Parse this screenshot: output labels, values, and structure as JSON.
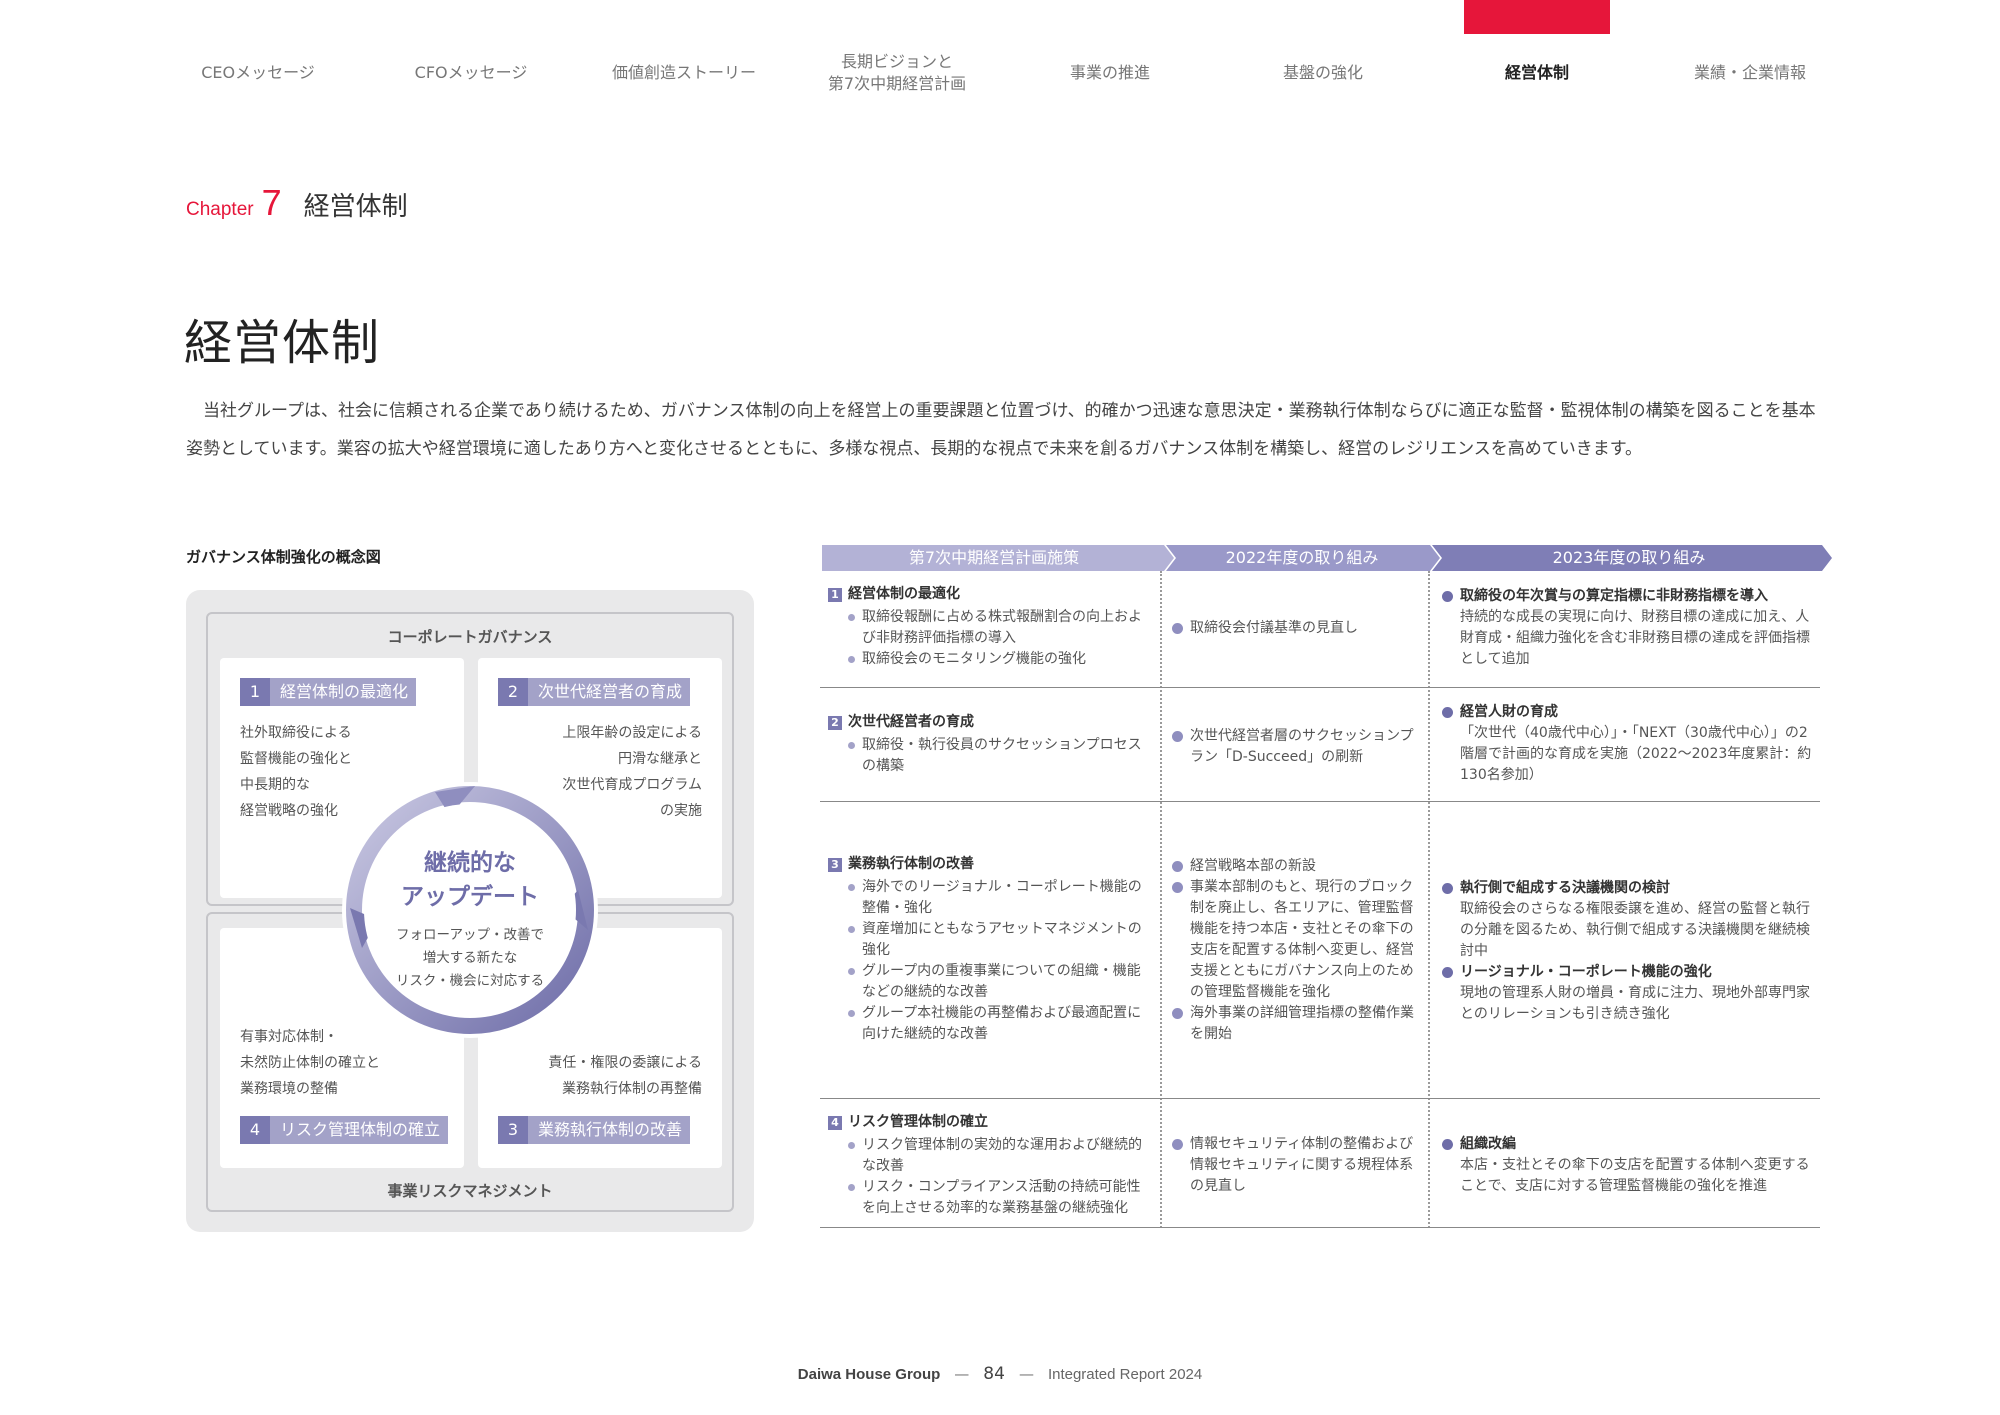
{
  "nav": {
    "items": [
      {
        "label": "CEOメッセージ",
        "label2": ""
      },
      {
        "label": "CFOメッセージ",
        "label2": ""
      },
      {
        "label": "価値創造ストーリー",
        "label2": ""
      },
      {
        "label": "長期ビジョンと",
        "label2": "第7次中期経営計画"
      },
      {
        "label": "事業の推進",
        "label2": ""
      },
      {
        "label": "基盤の強化",
        "label2": ""
      },
      {
        "label": "経営体制",
        "label2": ""
      },
      {
        "label": "業績・企業情報",
        "label2": ""
      }
    ],
    "active_index": 6,
    "marker_color": "#e6163a"
  },
  "chapter": {
    "word": "Chapter",
    "number": "7",
    "title": "経営体制"
  },
  "page_title": "経営体制",
  "intro": "当社グループは、社会に信頼される企業であり続けるため、ガバナンス体制の向上を経営上の重要課題と位置づけ、的確かつ迅速な意思決定・業務執行体制ならびに適正な監督・監視体制の構築を図ることを基本姿勢としています。業容の拡大や経営環境に適したあり方へと変化させるとともに、多様な視点、長期的な視点で未来を創るガバナンス体制を構築し、経営のレジリエンスを高めていきます。",
  "diagram": {
    "label": "ガバナンス体制強化の概念図",
    "top_title": "コーポレートガバナンス",
    "bottom_title": "事業リスクマネジメント",
    "cards": [
      {
        "num": "1",
        "title": "経営体制の最適化",
        "body": [
          "社外取締役による",
          "監督機能の強化と",
          "中長期的な",
          "経営戦略の強化"
        ]
      },
      {
        "num": "2",
        "title": "次世代経営者の育成",
        "body": [
          "上限年齢の設定による",
          "円滑な継承と",
          "次世代育成プログラム",
          "の実施"
        ]
      },
      {
        "num": "4",
        "title": "リスク管理体制の確立",
        "body": [
          "有事対応体制・",
          "未然防止体制の確立と",
          "業務環境の整備"
        ]
      },
      {
        "num": "3",
        "title": "業務執行体制の改善",
        "body": [
          "責任・権限の委譲による",
          "業務執行体制の再整備"
        ]
      }
    ],
    "center": {
      "title1": "継続的な",
      "title2": "アップデート",
      "sub": [
        "フォローアップ・改善で",
        "増大する新たな",
        "リスク・機会に対応する"
      ]
    },
    "accent": "#7a79b0"
  },
  "table": {
    "headers": [
      "第7次中期経営計画施策",
      "2022年度の取り組み",
      "2023年度の取り組み"
    ],
    "header_colors": [
      "#b3b2d6",
      "#9a99c9",
      "#7f7eb6"
    ],
    "rows": [
      {
        "num": "1",
        "title": "経営体制の最適化",
        "items": [
          "取締役報酬に占める株式報酬割合の向上および非財務評価指標の導入",
          "取締役会のモニタリング機能の強化"
        ],
        "fy2022": [
          "取締役会付議基準の見直し"
        ],
        "fy2023": [
          {
            "head": "取締役の年次賞与の算定指標に非財務指標を導入",
            "body": "持続的な成長の実現に向け、財務目標の達成に加え、人財育成・組織力強化を含む非財務目標の達成を評価指標として追加"
          }
        ]
      },
      {
        "num": "2",
        "title": "次世代経営者の育成",
        "items": [
          "取締役・執行役員のサクセッションプロセスの構築"
        ],
        "fy2022": [
          "次世代経営者層のサクセッションプラン「D-Succeed」の刷新"
        ],
        "fy2023": [
          {
            "head": "経営人財の育成",
            "body": "「次世代（40歳代中心）」・「NEXT（30歳代中心）」の2階層で計画的な育成を実施（2022～2023年度累計：約130名参加）"
          }
        ]
      },
      {
        "num": "3",
        "title": "業務執行体制の改善",
        "items": [
          "海外でのリージョナル・コーポレート機能の整備・強化",
          "資産増加にともなうアセットマネジメントの強化",
          "グループ内の重複事業についての組織・機能などの継続的な改善",
          "グループ本社機能の再整備および最適配置に向けた継続的な改善"
        ],
        "fy2022": [
          "経営戦略本部の新設",
          "事業本部制のもと、現行のブロック制を廃止し、各エリアに、管理監督機能を持つ本店・支社とその傘下の支店を配置する体制へ変更し、経営支援とともにガバナンス向上のための管理監督機能を強化",
          "海外事業の詳細管理指標の整備作業を開始"
        ],
        "fy2023": [
          {
            "head": "執行側で組成する決議機関の検討",
            "body": "取締役会のさらなる権限委譲を進め、経営の監督と執行の分離を図るため、執行側で組成する決議機関を継続検討中"
          },
          {
            "head": "リージョナル・コーポレート機能の強化",
            "body": "現地の管理系人財の増員・育成に注力、現地外部専門家とのリレーションも引き続き強化"
          }
        ]
      },
      {
        "num": "4",
        "title": "リスク管理体制の確立",
        "items": [
          "リスク管理体制の実効的な運用および継続的な改善",
          "リスク・コンプライアンス活動の持続可能性を向上させる効率的な業務基盤の継続強化"
        ],
        "fy2022": [
          "情報セキュリティ体制の整備および情報セキュリティに関する規程体系の見直し"
        ],
        "fy2023": [
          {
            "head": "組織改編",
            "body": "本店・支社とその傘下の支店を配置する体制へ変更することで、支店に対する管理監督機能の強化を推進"
          }
        ]
      }
    ]
  },
  "footer": {
    "brand": "Daiwa House Group",
    "page": "84",
    "report": "Integrated Report 2024"
  }
}
